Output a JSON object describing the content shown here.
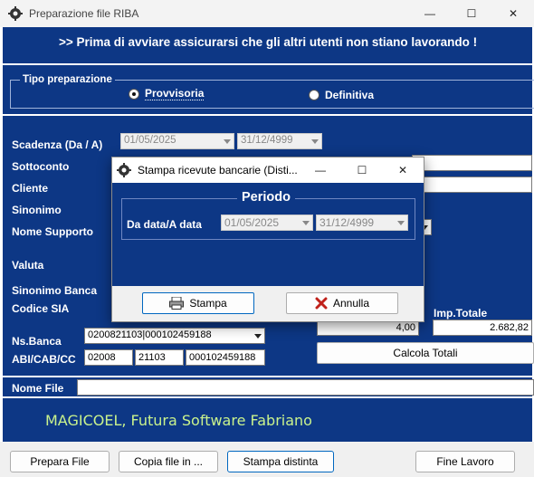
{
  "window": {
    "title": "Preparazione file RIBA",
    "minimize": "—",
    "maximize": "☐",
    "close": "✕"
  },
  "banner": ">>  Prima di avviare assicurarsi che gli altri utenti non stiano lavorando !",
  "tipo_preparazione": {
    "legend": "Tipo preparazione",
    "options": [
      "Provvisoria",
      "Definitiva"
    ],
    "selected": "Provvisoria"
  },
  "fields": {
    "scadenza_label": "Scadenza (Da / A)",
    "scadenza_da": "01/05/2025",
    "scadenza_a": "31/12/4999",
    "sottoconto_label": "Sottoconto",
    "cliente_label": "Cliente",
    "sinonimo_label": "Sinonimo",
    "nome_supporto_label": "Nome Supporto",
    "valuta_label": "Valuta",
    "sinonimo_banca_label": "Sinonimo Banca",
    "codice_sia_label": "Codice SIA",
    "ns_banca_label": "Ns.Banca",
    "ns_banca_value": "0200821103|000102459188",
    "abi_cab_cc_label": "ABI/CAB/CC",
    "abi": "02008",
    "cab": "21103",
    "cc": "000102459188",
    "imp_totale_label": "Imp.Totale",
    "count_value": "4,00",
    "imp_totale_value": "2.682,82",
    "calcola_totali": "Calcola Totali",
    "nome_file_label": "Nome File",
    "nome_file_value": ""
  },
  "footer_text": "MAGICOEL, Futura Software Fabriano",
  "buttons": {
    "prepara_file": "Prepara File",
    "copia_file": "Copia file in ...",
    "stampa_distinta": "Stampa distinta",
    "fine_lavoro": "Fine Lavoro"
  },
  "dialog": {
    "title": "Stampa ricevute bancarie (Disti...",
    "periodo": "Periodo",
    "da_data_label": "Da data/A data",
    "da_data": "01/05/2025",
    "a_data": "31/12/4999",
    "stampa": "Stampa",
    "annulla": "Annulla",
    "minimize": "—",
    "maximize": "☐",
    "close": "✕"
  },
  "colors": {
    "panel": "#0d3785",
    "accent_text": "#c9f28c"
  }
}
